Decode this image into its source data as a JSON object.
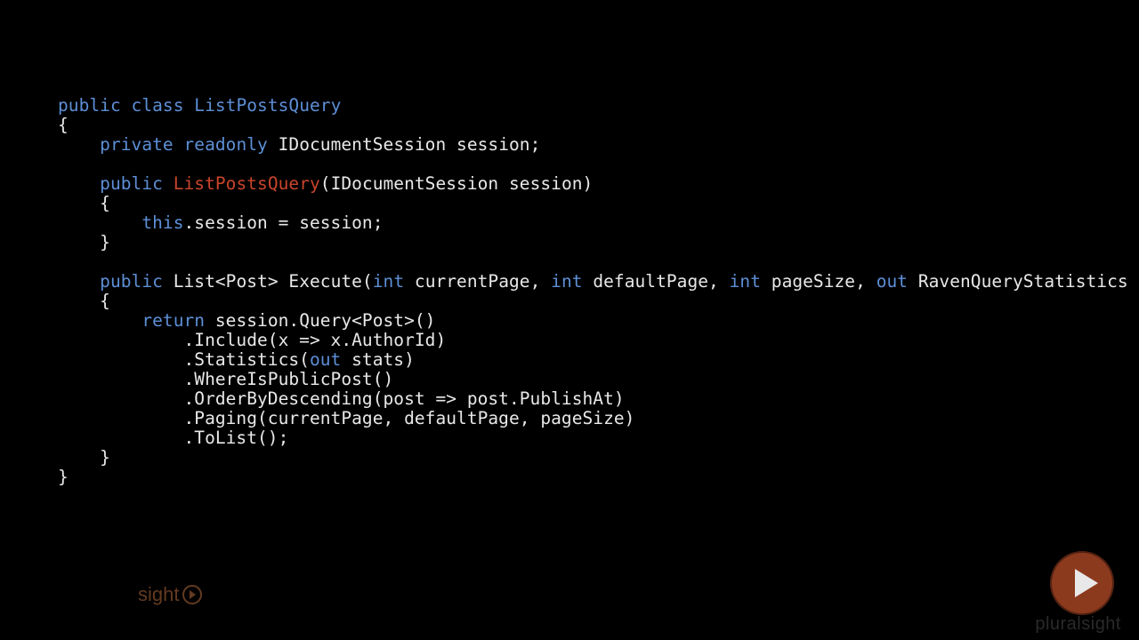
{
  "code": {
    "l1_a": "public",
    "l1_b": "class",
    "l1_c": "ListPostsQuery",
    "l2": "{",
    "l3_a": "private",
    "l3_b": "readonly",
    "l3_c": "IDocumentSession session;",
    "l4_a": "public",
    "l4_b": "ListPostsQuery",
    "l4_c": "(IDocumentSession session)",
    "l5": "{",
    "l6_a": "this",
    "l6_b": ".session = session;",
    "l7": "}",
    "l8_a": "public",
    "l8_b": "List<Post> Execute(",
    "l8_c": "int",
    "l8_d": " currentPage, ",
    "l8_e": "int",
    "l8_f": " defaultPage, ",
    "l8_g": "int",
    "l8_h": " pageSize, ",
    "l8_i": "out",
    "l8_j": " RavenQueryStatistics stats)",
    "l9": "{",
    "l10_a": "return",
    "l10_b": " session.Query<Post>()",
    "l11": ".Include(x => x.AuthorId)",
    "l12_a": ".Statistics(",
    "l12_b": "out",
    "l12_c": " stats)",
    "l13": ".WhereIsPublicPost()",
    "l14": ".OrderByDescending(post => post.PublishAt)",
    "l15": ".Paging(currentPage, defaultPage, pageSize)",
    "l16": ".ToList();",
    "l17": "}",
    "l18": "}"
  },
  "logo_text": "sight",
  "watermark": "pluralsight",
  "colors": {
    "bg": "#000000",
    "text": "#e8e8e8",
    "keyword": "#5d8fd6",
    "ctor": "#c8452b",
    "play_bg": "#8c3a1e",
    "logo": "#b56a3d"
  }
}
